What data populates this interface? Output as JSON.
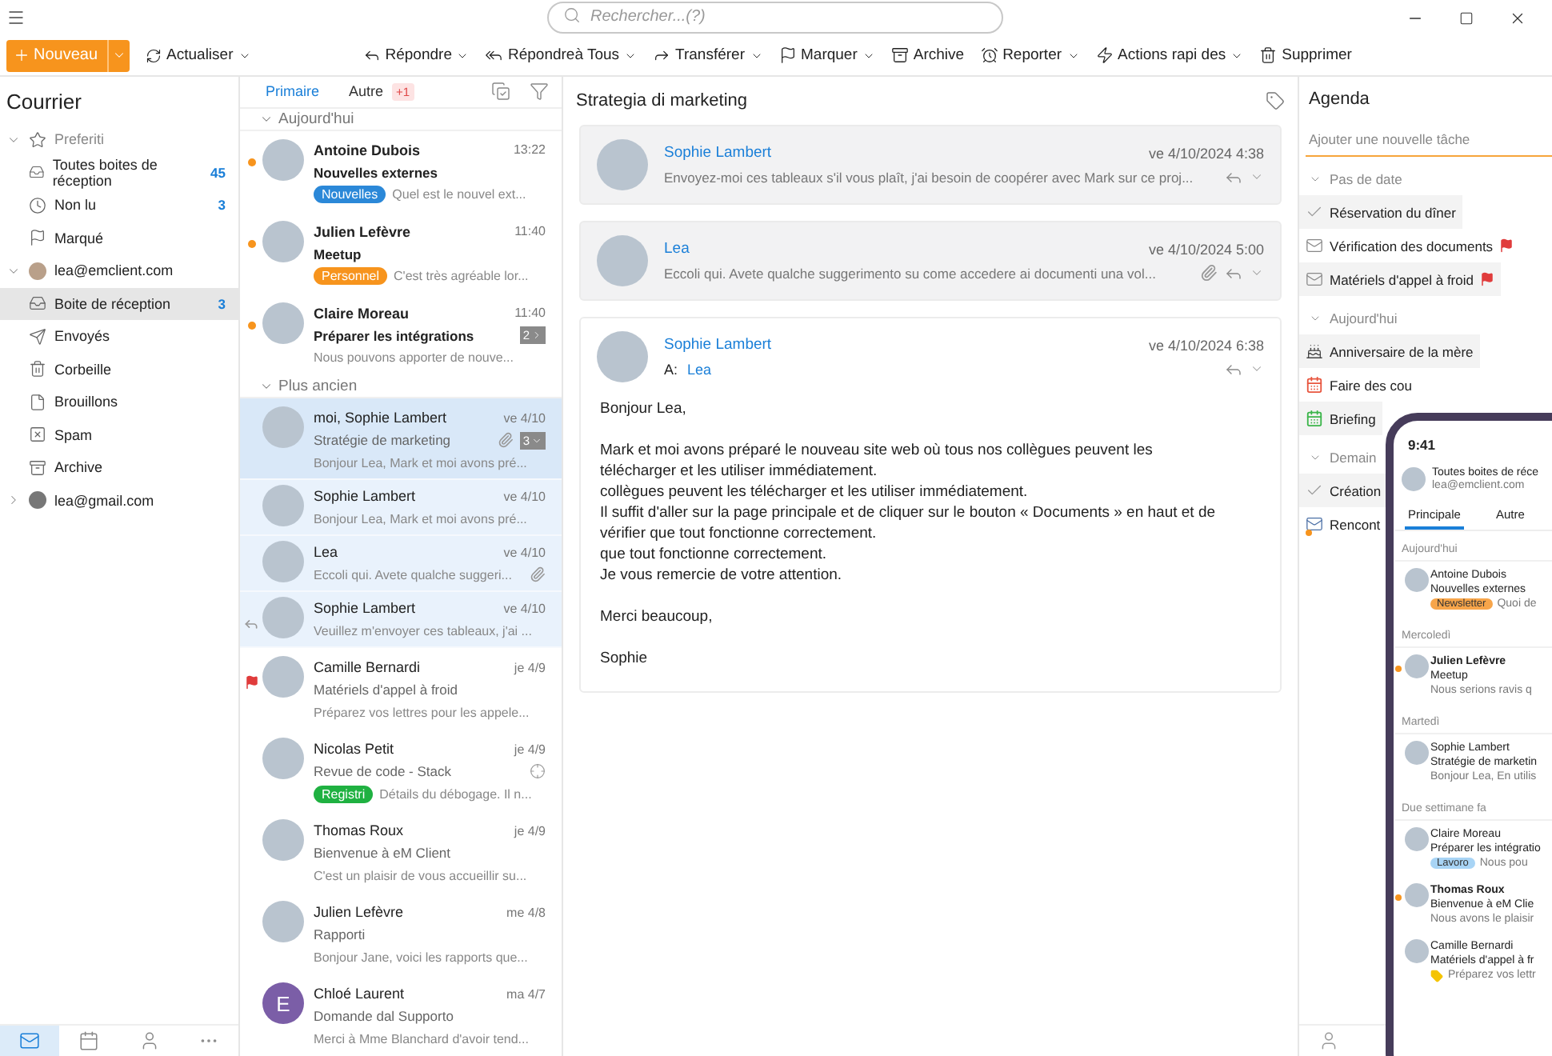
{
  "search": {
    "placeholder": "Rechercher...(?)"
  },
  "toolbar": {
    "new_label": "Nouveau",
    "refresh_label": "Actualiser",
    "actions": [
      {
        "label": "Répondre",
        "kind": "reply",
        "menu": true
      },
      {
        "label": "Répondreà Tous",
        "kind": "reply-all",
        "menu": true
      },
      {
        "label": "Transférer",
        "kind": "forward",
        "menu": true
      },
      {
        "label": "Marquer",
        "kind": "flag",
        "menu": true
      },
      {
        "label": "Archive",
        "kind": "archive",
        "menu": false
      },
      {
        "label": "Reporter",
        "kind": "snooze",
        "menu": true
      },
      {
        "label": "Actions rapi des",
        "kind": "quick",
        "menu": true
      },
      {
        "label": "Supprimer",
        "kind": "delete",
        "menu": false
      }
    ]
  },
  "sidebar": {
    "title": "Courrier",
    "tree": [
      {
        "label": "Preferiti",
        "kind": "favorites",
        "expanded": true,
        "children": [
          {
            "label": "Toutes boites de réception",
            "kind": "inbox",
            "count": "45",
            "selected": false
          },
          {
            "label": "Non lu",
            "kind": "unread",
            "count": "3",
            "selected": false
          },
          {
            "label": "Marqué",
            "kind": "flagged",
            "selected": false
          }
        ]
      },
      {
        "label": "lea@emclient.com",
        "kind": "account",
        "expanded": true,
        "children": [
          {
            "label": "Boite de réception",
            "kind": "inbox",
            "count": "3",
            "selected": true
          },
          {
            "label": "Envoyés",
            "kind": "sent",
            "selected": false
          },
          {
            "label": "Corbeille",
            "kind": "trash",
            "selected": false
          },
          {
            "label": "Brouillons",
            "kind": "drafts",
            "selected": false
          },
          {
            "label": "Spam",
            "kind": "spam",
            "selected": false
          },
          {
            "label": "Archive",
            "kind": "archive",
            "selected": false
          }
        ]
      },
      {
        "label": "lea@gmail.com",
        "kind": "account",
        "expanded": false
      }
    ]
  },
  "nav": [
    {
      "kind": "mail",
      "selected": true
    },
    {
      "kind": "calendar",
      "selected": false
    },
    {
      "kind": "contacts",
      "selected": false
    },
    {
      "kind": "more",
      "selected": false
    }
  ],
  "list": {
    "tabs": [
      {
        "label": "Primaire",
        "selected": true
      },
      {
        "label": "Autre",
        "badge": "+1",
        "selected": false
      }
    ],
    "groups": [
      {
        "label": "Aujourd'hui",
        "expanded": true,
        "messages": [
          {
            "sender": "Antoine Dubois",
            "time": "13:22",
            "subject": "Nouvelles externes",
            "preview": "Quel est le nouvel ext...",
            "tag": {
              "label": "Nouvelles",
              "color": "#2b88d8"
            },
            "unread": true,
            "selected": false,
            "highlighted": false,
            "flagged": false,
            "replied": false,
            "attachment": false
          },
          {
            "sender": "Julien Lefèvre",
            "time": "11:40",
            "subject": "Meetup",
            "preview": "C'est très agréable lor...",
            "tag": {
              "label": "Personnel",
              "color": "#f7941d"
            },
            "unread": true,
            "selected": false,
            "highlighted": false,
            "flagged": false,
            "replied": false,
            "attachment": false
          },
          {
            "sender": "Claire Moreau",
            "time": "11:40",
            "subject": "Préparer les intégrations",
            "preview": "Nous pouvons apporter de nouve...",
            "count": {
              "text": "2",
              "kind": "next"
            },
            "unread": true,
            "selected": false,
            "highlighted": false,
            "flagged": false,
            "replied": false,
            "attachment": false
          }
        ]
      },
      {
        "label": "Plus ancien",
        "expanded": true,
        "messages": [
          {
            "sender": "moi, Sophie Lambert",
            "time": "ve 4/10",
            "subject": "Stratégie de marketing",
            "preview": "Bonjour Lea, Mark et moi avons pré...",
            "count": {
              "text": "3",
              "kind": "expand"
            },
            "unread": false,
            "selected": true,
            "highlighted": true,
            "flagged": false,
            "replied": false,
            "attachment": true
          },
          {
            "sender": "Sophie Lambert",
            "time": "ve 4/10",
            "preview": "Bonjour Lea, Mark et moi avons pré...",
            "unread": false,
            "selected": false,
            "highlighted": true,
            "flagged": false,
            "replied": false,
            "attachment": false
          },
          {
            "sender": "Lea",
            "time": "ve 4/10",
            "preview": "Eccoli qui. Avete qualche suggeri...",
            "unread": false,
            "selected": false,
            "highlighted": true,
            "flagged": false,
            "replied": false,
            "attachment": true
          },
          {
            "sender": "Sophie Lambert",
            "time": "ve 4/10",
            "preview": "Veuillez m'envoyer ces tableaux, j'ai ...",
            "unread": false,
            "selected": false,
            "highlighted": true,
            "flagged": false,
            "replied": true,
            "attachment": false
          },
          {
            "sender": "Camille Bernardi",
            "time": "je 4/9",
            "subject": "Matériels d'appel à froid",
            "preview": "Préparez vos lettres pour les appele...",
            "unread": false,
            "selected": false,
            "highlighted": false,
            "flagged": true,
            "replied": false,
            "attachment": false
          },
          {
            "sender": "Nicolas Petit",
            "time": "je 4/9",
            "subject": "Revue de code - Stack",
            "preview": "Détails du débogage. Il n...",
            "tag": {
              "label": "Registri",
              "color": "#1fb141"
            },
            "kind": "target",
            "unread": false,
            "selected": false,
            "highlighted": false,
            "flagged": false,
            "replied": false,
            "attachment": false
          },
          {
            "sender": "Thomas Roux",
            "time": "je 4/9",
            "subject": "Bienvenue à eM Client",
            "preview": "C'est un plaisir de vous accueillir su...",
            "unread": false,
            "selected": false,
            "highlighted": false,
            "flagged": false,
            "replied": false,
            "attachment": false
          },
          {
            "sender": "Julien Lefèvre",
            "time": "me 4/8",
            "subject": "Rapporti",
            "preview": "Bonjour Jane, voici les rapports que...",
            "unread": false,
            "selected": false,
            "highlighted": false,
            "flagged": false,
            "replied": false,
            "attachment": false
          },
          {
            "sender": "Chloé Laurent",
            "time": "ma 4/7",
            "subject": "Domande dal Supporto",
            "preview": "Merci à Mme Blanchard d'avoir tend...",
            "initial": "E",
            "unread": false,
            "selected": false,
            "highlighted": false,
            "flagged": false,
            "replied": false,
            "attachment": false
          }
        ]
      }
    ]
  },
  "reader": {
    "title": "Strategia di marketing",
    "messages": [
      {
        "sender": "Sophie Lambert",
        "date": "ve 4/10/2024 4:38",
        "preview": "Envoyez-moi ces tableaux s'il vous plaît, j'ai besoin de coopérer avec Mark sur ce proj...",
        "expanded": false,
        "attachment": false
      },
      {
        "sender": "Lea",
        "date": "ve 4/10/2024 5:00",
        "preview": "Eccoli qui. Avete qualche suggerimento su come accedere ai documenti una vol...",
        "expanded": false,
        "attachment": true
      },
      {
        "sender": "Sophie Lambert",
        "date": "ve 4/10/2024 6:38",
        "to_label": "A:",
        "to": "Lea",
        "expanded": true,
        "attachment": false,
        "body": [
          "Bonjour Lea,",
          "Mark et moi avons préparé le nouveau site web où tous nos collègues peuvent les\ntélécharger et les utiliser immédiatement.\ncollègues peuvent les télécharger et les utiliser immédiatement.\nIl suffit d'aller sur la page principale et de cliquer sur le bouton « Documents » en haut et de\nvérifier que tout fonctionne correctement.\nque tout fonctionne correctement.\nJe vous remercie de votre attention.",
          "Merci beaucoup,",
          "Sophie"
        ]
      }
    ]
  },
  "agenda": {
    "title": "Agenda",
    "placeholder": "Ajouter une nouvelle tâche",
    "groups": [
      {
        "label": "Pas de date",
        "expanded": true,
        "items": [
          {
            "label": "Réservation du dîner",
            "kind": "task",
            "flagged": false
          },
          {
            "label": "Vérification des documents",
            "kind": "mail",
            "flagged": true
          },
          {
            "label": "Matériels d'appel à froid",
            "kind": "mail",
            "flagged": true
          }
        ]
      },
      {
        "label": "Aujourd'hui",
        "expanded": true,
        "items": [
          {
            "label": "Anniversaire de la mère",
            "kind": "birthday",
            "flagged": false
          },
          {
            "label": "Faire des cou",
            "kind": "event",
            "color": "#e8553e",
            "flagged": false
          },
          {
            "label": "Briefing",
            "kind": "event",
            "color": "#3bb54a",
            "flagged": false
          }
        ]
      },
      {
        "label": "Demain",
        "expanded": true,
        "items": [
          {
            "label": "Création",
            "kind": "task",
            "flagged": false
          },
          {
            "label": "Rencont",
            "kind": "invite",
            "flagged": false
          }
        ]
      }
    ]
  },
  "phone": {
    "time": "9:41",
    "account": "Toutes boites de réce",
    "email": "lea@emclient.com",
    "tabs": [
      {
        "label": "Principale",
        "selected": true
      },
      {
        "label": "Autre",
        "selected": false
      }
    ],
    "groups": [
      {
        "label": "Aujourd'hui",
        "messages": [
          {
            "sender": "Antoine Dubois",
            "subject": "Nouvelles externes",
            "preview": "Quoi de",
            "tag": {
              "label": "Newsletter",
              "color": "#f7a54a"
            },
            "unread": false,
            "marker": false
          }
        ]
      },
      {
        "label": "Mercoledì",
        "messages": [
          {
            "sender": "Julien Lefèvre",
            "subject": "Meetup",
            "preview": "Nous serions ravis q",
            "unread": true,
            "marker": false
          }
        ]
      },
      {
        "label": "Martedì",
        "messages": [
          {
            "sender": "Sophie Lambert",
            "subject": "Stratégie de marketin",
            "preview": "Bonjour Lea, En utilis",
            "unread": false,
            "marker": false
          }
        ]
      },
      {
        "label": "Due settimane fa",
        "messages": [
          {
            "sender": "Claire Moreau",
            "subject": "Préparer les intégratio",
            "preview": "Nous pou",
            "tag": {
              "label": "Lavoro",
              "color": "#a8d4f5"
            },
            "unread": false,
            "marker": false
          },
          {
            "sender": "Thomas Roux",
            "subject": "Bienvenue à eM Clie",
            "preview": "Nous avons le plaisir",
            "unread": true,
            "marker": false
          },
          {
            "sender": "Camille Bernardi",
            "subject": "Matériels d'appel à fr",
            "preview": "Préparez vos lettr",
            "unread": false,
            "marker": true
          }
        ]
      }
    ]
  }
}
